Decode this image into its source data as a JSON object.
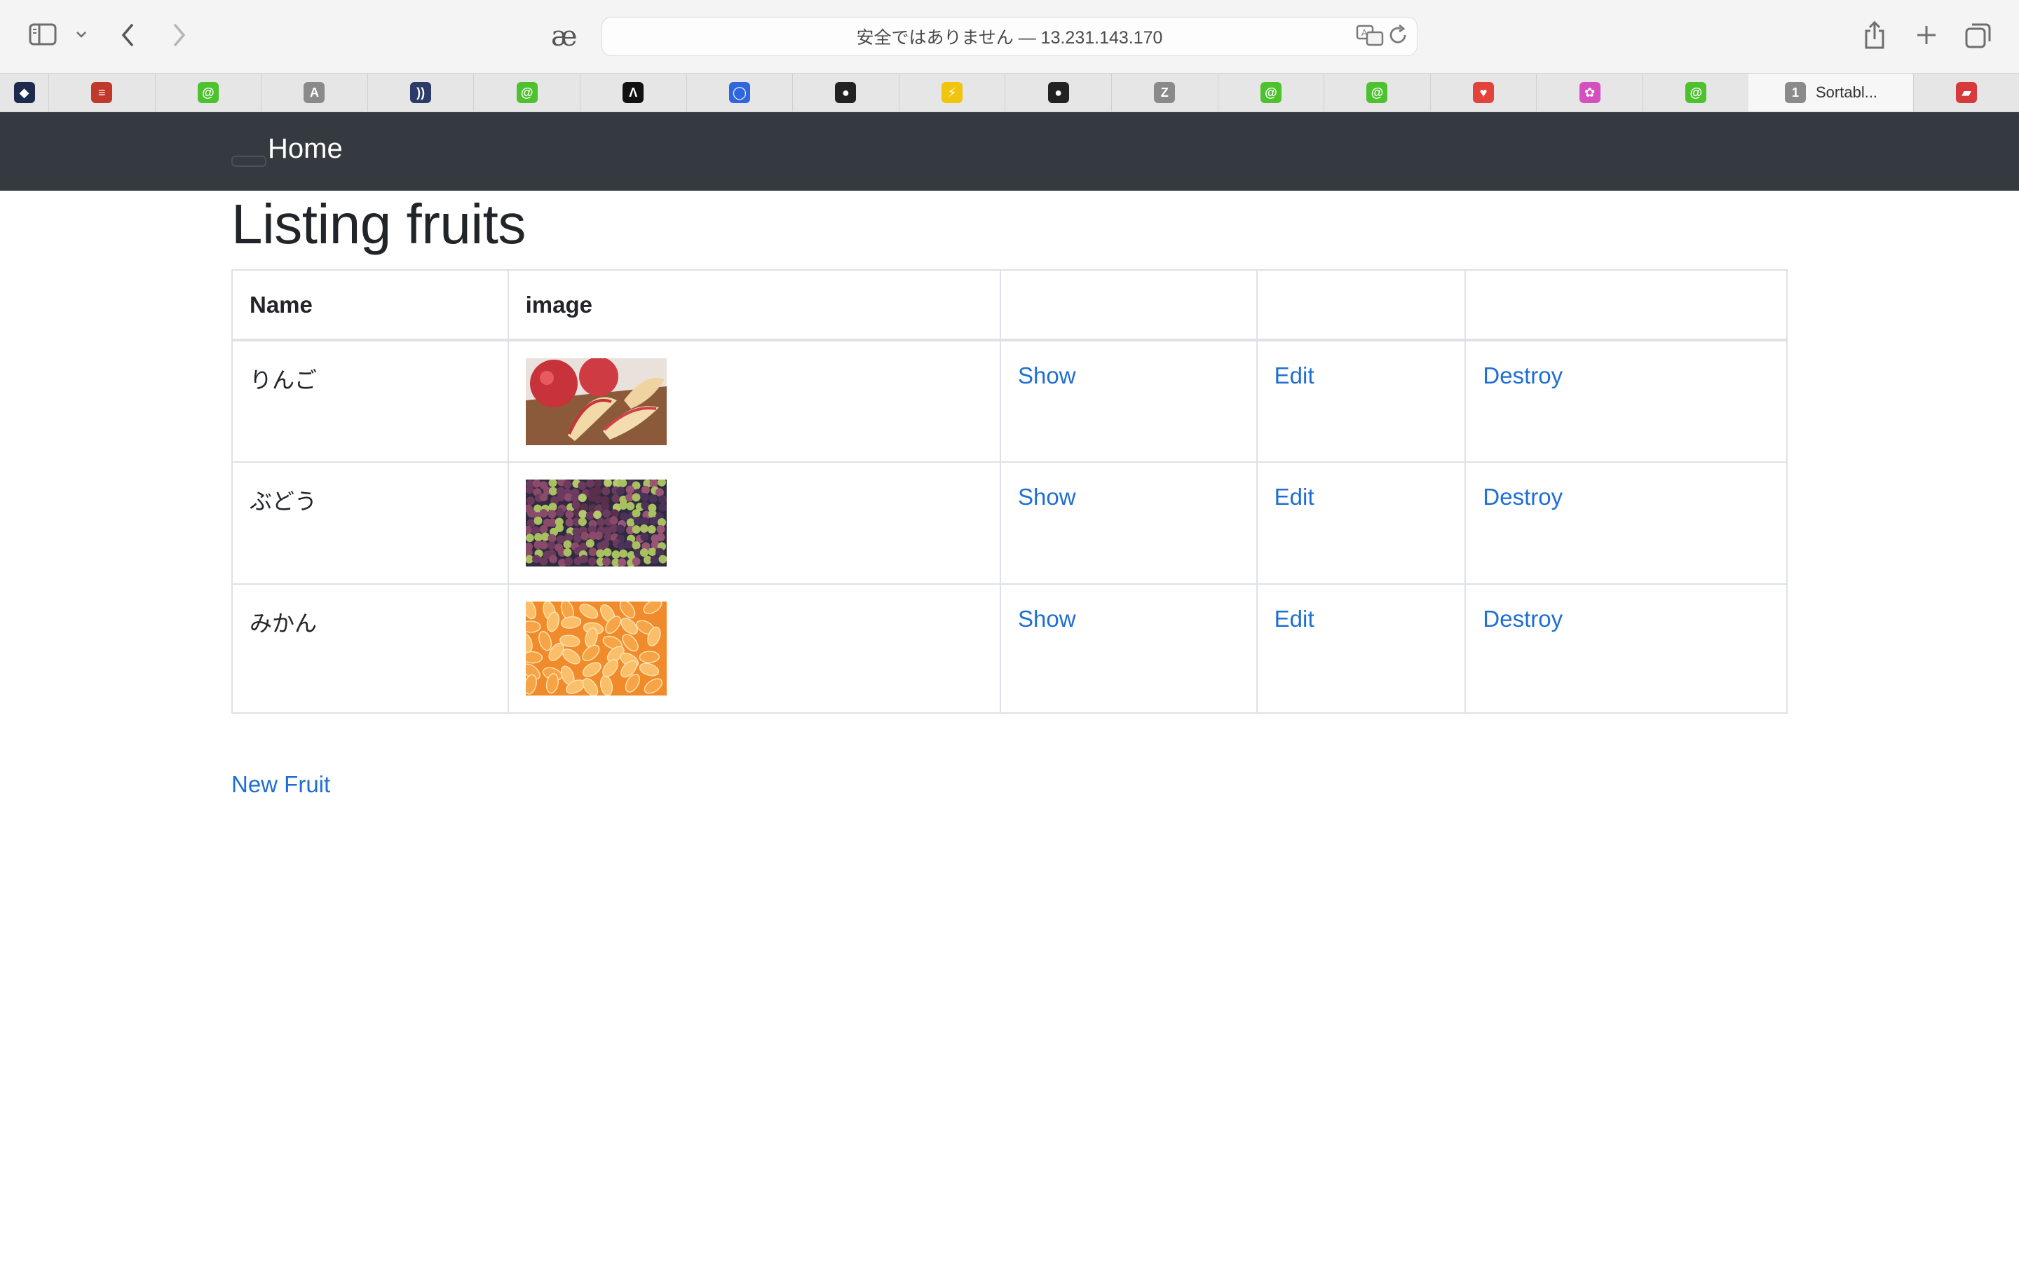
{
  "browser": {
    "url_text": "安全ではありません — 13.231.143.170",
    "ae_label": "æ",
    "active_tab_badge": "1",
    "active_tab_title": "Sortabl..."
  },
  "tabs": [
    {
      "icon": "codepen-hex-icon",
      "color": "#1d2c4c",
      "glyph": "◆"
    },
    {
      "icon": "stackoverflow-icon",
      "color": "#c0392b",
      "glyph": "≡"
    },
    {
      "icon": "green-ring-icon",
      "color": "#4ec12f",
      "glyph": "@"
    },
    {
      "icon": "font-a-icon",
      "color": "#8a8a8a",
      "glyph": "A"
    },
    {
      "icon": "stripes-icon",
      "color": "#2d3b6b",
      "glyph": "))"
    },
    {
      "icon": "green-ring-icon",
      "color": "#4ec12f",
      "glyph": "@"
    },
    {
      "icon": "lambda-icon",
      "color": "#111111",
      "glyph": "Λ"
    },
    {
      "icon": "blue-circle-icon",
      "color": "#2f66e0",
      "glyph": "◯"
    },
    {
      "icon": "github-icon",
      "color": "#222222",
      "glyph": "●"
    },
    {
      "icon": "lightning-icon",
      "color": "#f1c40f",
      "glyph": "⚡"
    },
    {
      "icon": "github-icon",
      "color": "#222222",
      "glyph": "●"
    },
    {
      "icon": "font-z-icon",
      "color": "#8a8a8a",
      "glyph": "Z"
    },
    {
      "icon": "green-ring-icon",
      "color": "#4ec12f",
      "glyph": "@"
    },
    {
      "icon": "green-ring-icon",
      "color": "#4ec12f",
      "glyph": "@"
    },
    {
      "icon": "red-shield-icon",
      "color": "#e2443b",
      "glyph": "♥"
    },
    {
      "icon": "flower-icon",
      "color": "#d64fbf",
      "glyph": "✿"
    },
    {
      "icon": "green-ring-icon",
      "color": "#4ec12f",
      "glyph": "@"
    }
  ],
  "navbar": {
    "brand": "Home"
  },
  "page": {
    "title": "Listing fruits",
    "new_link": "New Fruit"
  },
  "table": {
    "headers": [
      "Name",
      "image",
      "",
      "",
      ""
    ],
    "rows": [
      {
        "name": "りんご",
        "image": "apple-photo",
        "show": "Show",
        "edit": "Edit",
        "destroy": "Destroy"
      },
      {
        "name": "ぶどう",
        "image": "grape-photo",
        "show": "Show",
        "edit": "Edit",
        "destroy": "Destroy"
      },
      {
        "name": "みかん",
        "image": "mandarin-photo",
        "show": "Show",
        "edit": "Edit",
        "destroy": "Destroy"
      }
    ]
  },
  "colors": {
    "navbar_bg": "#343a40",
    "link": "#1f6ed4",
    "text": "#212529"
  }
}
